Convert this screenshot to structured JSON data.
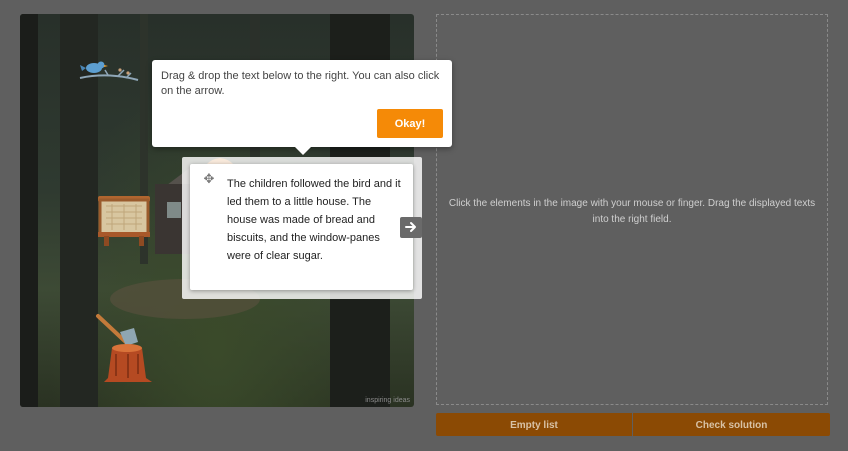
{
  "scene": {
    "watermark": "inspiring ideas",
    "hotspots": [
      "bird-branch",
      "notice-board",
      "axe-stump",
      "bread-house"
    ]
  },
  "dropzone": {
    "instruction": "Click the elements in the image with your mouse or finger. Drag the displayed texts into the right field."
  },
  "buttons": {
    "empty_list": "Empty list",
    "check_solution": "Check solution"
  },
  "tooltip": {
    "text": "Drag & drop the text below to the right. You can also click on the arrow.",
    "okay": "Okay!"
  },
  "card": {
    "text": "The children followed the bird and it led them to a little house. The house was made of bread and biscuits, and the window-panes were of clear sugar.",
    "move_icon": "move-icon",
    "arrow_icon": "arrow-right-icon"
  },
  "colors": {
    "overlay": "#5f5f5f",
    "accent": "#f58a07",
    "button_dimmed": "#8b4a04"
  }
}
